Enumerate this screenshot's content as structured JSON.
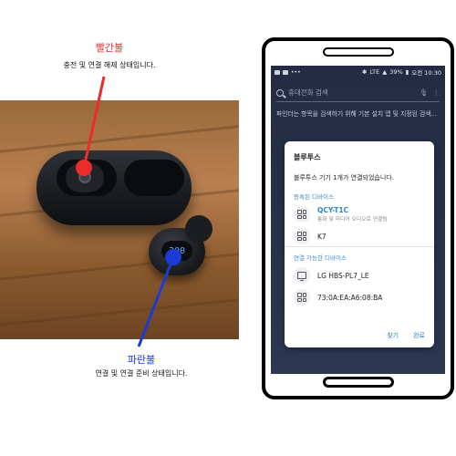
{
  "annotations": {
    "red": {
      "title": "빨간불",
      "desc": "충전 및 연결 해제 상태입니다.",
      "color": "#ee2b2b"
    },
    "blue": {
      "title": "파란불",
      "desc": "연결 및 연결 준비 상태입니다.",
      "color": "#1a3bd6"
    }
  },
  "earbud_display": "300",
  "phone": {
    "status_bar": {
      "battery": "39%",
      "time": "오전 10:30",
      "network": "LTE"
    },
    "search": {
      "placeholder": "휴대전화 검색"
    },
    "background_text": "파인더는 항목을 검색하기 위해 기본 설치 앱 및 지정된 검색...",
    "dialog": {
      "title": "블루투스",
      "message": "블루투스 기기 1개가 연결되었습니다.",
      "registered_section": "등록된 디바이스",
      "registered_devices": [
        {
          "name": "QCY-T1C",
          "sub": "통화 및 미디어 오디오로 연결됨",
          "icon": "device-grid-icon"
        },
        {
          "name": "K7",
          "sub": "",
          "icon": "device-grid-icon"
        }
      ],
      "available_section": "연결 가능한 디바이스",
      "available_devices": [
        {
          "name": "LG HBS-PL7_LE",
          "icon": "monitor-icon"
        },
        {
          "name": "73:0A:EA:A6:08:BA",
          "icon": "device-grid-icon"
        }
      ],
      "scan_label": "찾기",
      "done_label": "완료"
    }
  }
}
